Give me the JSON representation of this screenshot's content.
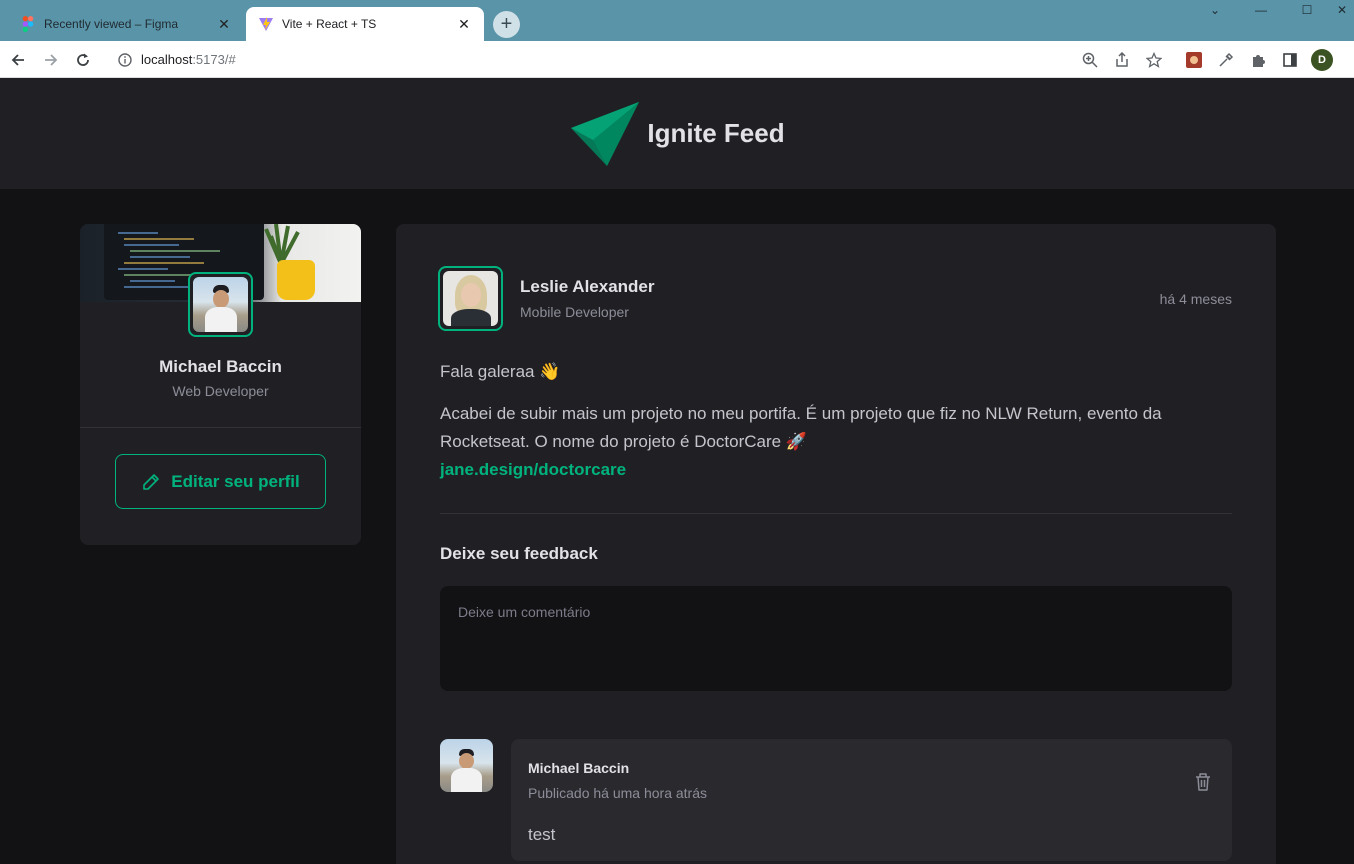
{
  "browser": {
    "tabs": [
      {
        "title": "Recently viewed – Figma",
        "active": false
      },
      {
        "title": "Vite + React + TS",
        "active": true
      }
    ],
    "url_host": "localhost",
    "url_rest": ":5173/#",
    "profile_initial": "D"
  },
  "header": {
    "logo_text": "Ignite Feed"
  },
  "sidebar": {
    "name": "Michael Baccin",
    "role": "Web Developer",
    "edit_label": "Editar seu perfil"
  },
  "post": {
    "author_name": "Leslie Alexander",
    "author_role": "Mobile Developer",
    "published": "há 4 meses",
    "paragraph_1": "Fala galeraa 👋",
    "paragraph_2": "Acabei de subir mais um projeto no meu portifa. É um projeto que fiz no NLW Return, evento da Rocketseat. O nome do projeto é DoctorCare 🚀",
    "link": "jane.design/doctorcare",
    "feedback_title": "Deixe seu feedback",
    "feedback_placeholder": "Deixe um comentário"
  },
  "comment": {
    "author": "Michael Baccin",
    "time": "Publicado há uma hora atrás",
    "text": "test"
  },
  "colors": {
    "accent": "#00b37e",
    "background": "#121214",
    "card": "#202024",
    "comment_bg": "#29292e"
  }
}
